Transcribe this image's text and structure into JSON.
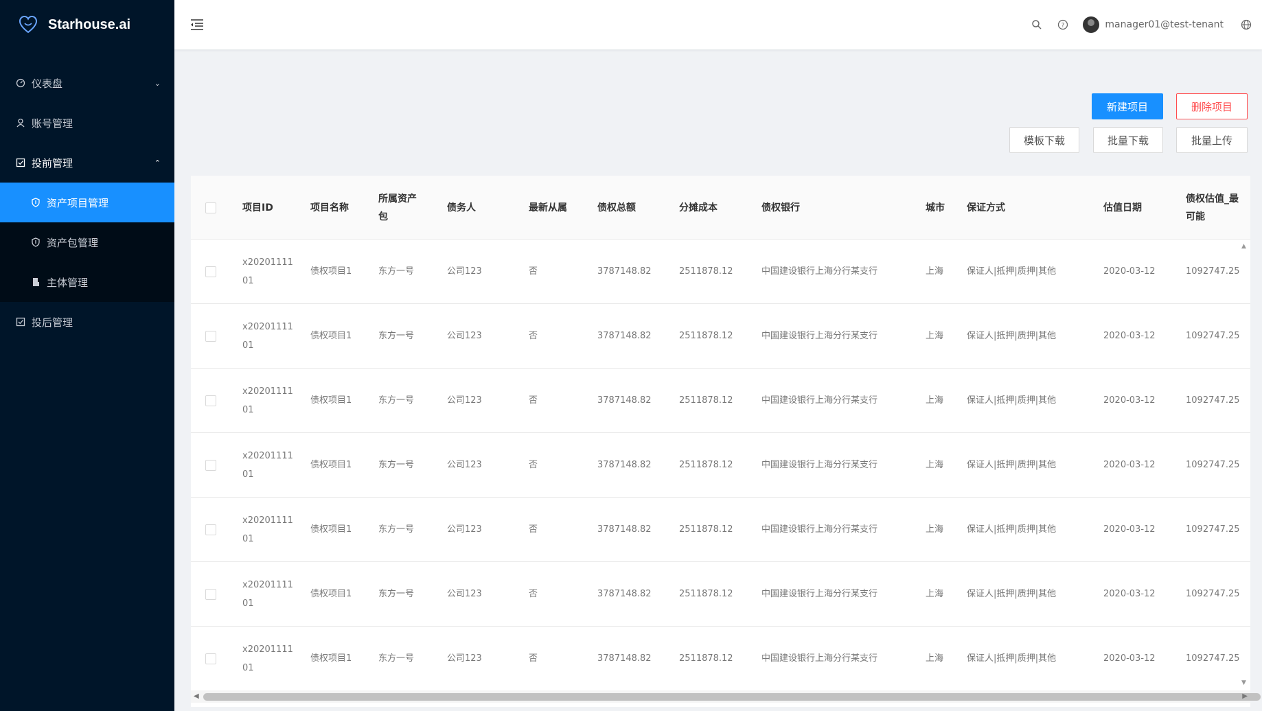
{
  "brand": {
    "name": "Starhouse.ai",
    "accent": "#1890ff",
    "danger": "#ff4d4f",
    "sidebar_bg": "#001529"
  },
  "sidebar": {
    "items": [
      {
        "label": "仪表盘",
        "icon": "dashboard-icon",
        "arrow": "chevron-down"
      },
      {
        "label": "账号管理",
        "icon": "user-icon"
      },
      {
        "label": "投前管理",
        "icon": "check-square-icon",
        "arrow": "chevron-up"
      },
      {
        "label": "资产项目管理",
        "icon": "shield-icon",
        "active": true
      },
      {
        "label": "资产包管理",
        "icon": "shield-icon"
      },
      {
        "label": "主体管理",
        "icon": "building-icon"
      },
      {
        "label": "投后管理",
        "icon": "check-square-icon"
      }
    ]
  },
  "header": {
    "user": "manager01@test-tenant",
    "icons": [
      "menu-fold-icon",
      "search-icon",
      "help-icon",
      "avatar",
      "globe-icon"
    ]
  },
  "toolbar": {
    "new_project": "新建项目",
    "delete_project": "删除项目",
    "template_download": "模板下载",
    "batch_download": "批量下载",
    "batch_upload": "批量上传"
  },
  "table": {
    "columns": [
      "项目ID",
      "项目名称",
      "所属资产包",
      "债务人",
      "最新从属",
      "债权总额",
      "分摊成本",
      "债权银行",
      "城市",
      "保证方式",
      "估值日期",
      "债权估值_最可能"
    ],
    "rows": [
      [
        "x2020111101",
        "债权项目1",
        "东方一号",
        "公司123",
        "否",
        "3787148.82",
        "2511878.12",
        "中国建设银行上海分行某支行",
        "上海",
        "保证人|抵押|质押|其他",
        "2020-03-12",
        "1092747.25"
      ],
      [
        "x2020111101",
        "债权项目1",
        "东方一号",
        "公司123",
        "否",
        "3787148.82",
        "2511878.12",
        "中国建设银行上海分行某支行",
        "上海",
        "保证人|抵押|质押|其他",
        "2020-03-12",
        "1092747.25"
      ],
      [
        "x2020111101",
        "债权项目1",
        "东方一号",
        "公司123",
        "否",
        "3787148.82",
        "2511878.12",
        "中国建设银行上海分行某支行",
        "上海",
        "保证人|抵押|质押|其他",
        "2020-03-12",
        "1092747.25"
      ],
      [
        "x2020111101",
        "债权项目1",
        "东方一号",
        "公司123",
        "否",
        "3787148.82",
        "2511878.12",
        "中国建设银行上海分行某支行",
        "上海",
        "保证人|抵押|质押|其他",
        "2020-03-12",
        "1092747.25"
      ],
      [
        "x2020111101",
        "债权项目1",
        "东方一号",
        "公司123",
        "否",
        "3787148.82",
        "2511878.12",
        "中国建设银行上海分行某支行",
        "上海",
        "保证人|抵押|质押|其他",
        "2020-03-12",
        "1092747.25"
      ],
      [
        "x2020111101",
        "债权项目1",
        "东方一号",
        "公司123",
        "否",
        "3787148.82",
        "2511878.12",
        "中国建设银行上海分行某支行",
        "上海",
        "保证人|抵押|质押|其他",
        "2020-03-12",
        "1092747.25"
      ],
      [
        "x2020111101",
        "债权项目1",
        "东方一号",
        "公司123",
        "否",
        "3787148.82",
        "2511878.12",
        "中国建设银行上海分行某支行",
        "上海",
        "保证人|抵押|质押|其他",
        "2020-03-12",
        "1092747.25"
      ]
    ]
  }
}
